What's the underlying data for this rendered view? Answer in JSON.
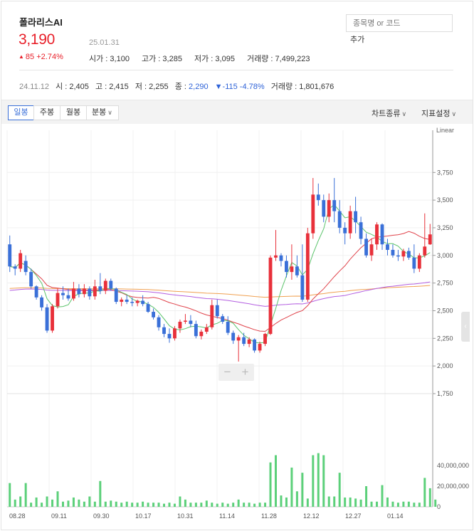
{
  "stock": {
    "name": "폴라리스AI",
    "price": "3,190",
    "date": "25.01.31",
    "change_abs": "85",
    "change_pct": "+2.74%",
    "open": "시가 : 3,100",
    "high": "고가 : 3,285",
    "low": "저가 : 3,095",
    "volume": "거래량 : 7,499,223"
  },
  "search": {
    "placeholder": "종목명 or 코드",
    "add_label": "추가"
  },
  "previous": {
    "date": "24.11.12",
    "open": "시 : 2,405",
    "high": "고 : 2,415",
    "low": "저 : 2,255",
    "close_label": "종 :",
    "close_value": "2,290",
    "change": "▼-115",
    "pct": "-4.78%",
    "volume": "거래량 : 1,801,676"
  },
  "toolbar": {
    "tabs": [
      "일봉",
      "주봉",
      "월봉",
      "분봉"
    ],
    "chart_type": "차트종류",
    "indicator": "지표설정"
  },
  "colors": {
    "up": "#e8303a",
    "down": "#3a70d8",
    "volume": "#5cd07a",
    "ma5": "#5cc46c",
    "ma20": "#e0434b",
    "ma60": "#b35ee0",
    "ma120": "#f0a050"
  },
  "chart_data": {
    "type": "candlestick",
    "price_scale": "Linear",
    "y_ticks": [
      "3,750",
      "3,500",
      "3,250",
      "3,000",
      "2,750",
      "2,500",
      "2,250",
      "2,000",
      "1,750"
    ],
    "y_range": [
      1750,
      3900
    ],
    "volume_ticks": [
      "40,000,000",
      "20,000,000",
      "0"
    ],
    "x_labels": [
      "08.28",
      "09.11",
      "09.30",
      "10.17",
      "10.31",
      "11.14",
      "11.28",
      "12.12",
      "12.27",
      "01.14"
    ],
    "candles": [
      [
        3100,
        3180,
        2850,
        2900
      ],
      [
        2900,
        2920,
        2820,
        2880
      ],
      [
        2880,
        3050,
        2850,
        3020
      ],
      [
        2950,
        3000,
        2820,
        2850
      ],
      [
        2850,
        2880,
        2700,
        2720
      ],
      [
        2720,
        2730,
        2600,
        2620
      ],
      [
        2620,
        2640,
        2500,
        2530
      ],
      [
        2530,
        2560,
        2300,
        2320
      ],
      [
        2320,
        2560,
        2300,
        2540
      ],
      [
        2540,
        2700,
        2520,
        2660
      ],
      [
        2660,
        2720,
        2600,
        2640
      ],
      [
        2640,
        2700,
        2590,
        2610
      ],
      [
        2610,
        2760,
        2590,
        2700
      ],
      [
        2700,
        2740,
        2620,
        2650
      ],
      [
        2650,
        2740,
        2620,
        2700
      ],
      [
        2700,
        2720,
        2600,
        2630
      ],
      [
        2630,
        2780,
        2600,
        2720
      ],
      [
        2720,
        2840,
        2650,
        2680
      ],
      [
        2680,
        2790,
        2650,
        2770
      ],
      [
        2770,
        2790,
        2680,
        2700
      ],
      [
        2700,
        2710,
        2560,
        2580
      ],
      [
        2580,
        2620,
        2540,
        2600
      ],
      [
        2600,
        2640,
        2560,
        2580
      ],
      [
        2580,
        2620,
        2540,
        2570
      ],
      [
        2570,
        2600,
        2540,
        2590
      ],
      [
        2590,
        2640,
        2540,
        2560
      ],
      [
        2560,
        2580,
        2480,
        2490
      ],
      [
        2490,
        2520,
        2420,
        2440
      ],
      [
        2440,
        2460,
        2320,
        2350
      ],
      [
        2350,
        2380,
        2260,
        2290
      ],
      [
        2290,
        2340,
        2210,
        2250
      ],
      [
        2250,
        2360,
        2230,
        2340
      ],
      [
        2340,
        2420,
        2300,
        2400
      ],
      [
        2400,
        2470,
        2380,
        2410
      ],
      [
        2410,
        2460,
        2350,
        2380
      ],
      [
        2380,
        2410,
        2250,
        2270
      ],
      [
        2270,
        2330,
        2240,
        2310
      ],
      [
        2310,
        2380,
        2290,
        2350
      ],
      [
        2350,
        2600,
        2330,
        2550
      ],
      [
        2550,
        2600,
        2430,
        2450
      ],
      [
        2450,
        2470,
        2380,
        2400
      ],
      [
        2400,
        2450,
        2280,
        2300
      ],
      [
        2300,
        2320,
        2200,
        2230
      ],
      [
        2230,
        2280,
        2040,
        2260
      ],
      [
        2260,
        2300,
        2180,
        2200
      ],
      [
        2200,
        2260,
        2170,
        2240
      ],
      [
        2240,
        2250,
        2120,
        2140
      ],
      [
        2140,
        2220,
        2120,
        2200
      ],
      [
        2200,
        2300,
        2180,
        2290
      ],
      [
        2290,
        3000,
        2280,
        2980
      ],
      [
        2980,
        3230,
        2950,
        3000
      ],
      [
        3000,
        3020,
        2900,
        2950
      ],
      [
        2950,
        3000,
        2800,
        2850
      ],
      [
        2850,
        3100,
        2780,
        2900
      ],
      [
        2900,
        3000,
        2800,
        2820
      ],
      [
        2820,
        3100,
        2580,
        2600
      ],
      [
        2600,
        3250,
        2580,
        3200
      ],
      [
        3200,
        3700,
        3150,
        3550
      ],
      [
        3550,
        3650,
        3450,
        3500
      ],
      [
        3500,
        3550,
        3300,
        3350
      ],
      [
        3350,
        3560,
        3300,
        3500
      ],
      [
        3500,
        3700,
        3300,
        3400
      ],
      [
        3400,
        3500,
        3200,
        3250
      ],
      [
        3250,
        3300,
        3100,
        3200
      ],
      [
        3200,
        3450,
        3150,
        3400
      ],
      [
        3400,
        3530,
        3200,
        3300
      ],
      [
        3300,
        3350,
        3100,
        3150
      ],
      [
        3150,
        3200,
        2980,
        3000
      ],
      [
        3000,
        3150,
        2950,
        3100
      ],
      [
        3100,
        3300,
        3050,
        3280
      ],
      [
        3280,
        3290,
        3050,
        3100
      ],
      [
        3100,
        3150,
        3000,
        3050
      ],
      [
        3050,
        3100,
        2980,
        3000
      ],
      [
        3000,
        3050,
        2950,
        2990
      ],
      [
        2990,
        3060,
        2950,
        3040
      ],
      [
        3040,
        3070,
        2960,
        2980
      ],
      [
        2980,
        3100,
        2840,
        2880
      ],
      [
        2880,
        3020,
        2850,
        3000
      ],
      [
        3000,
        3380,
        2980,
        3080
      ],
      [
        3100,
        3285,
        3095,
        3190
      ]
    ],
    "volume": [
      23,
      7,
      10,
      23,
      4,
      9,
      4,
      10,
      7,
      15,
      5,
      6,
      9,
      7,
      5,
      10,
      5,
      25,
      5,
      6,
      5,
      4,
      5,
      4,
      4,
      5,
      4,
      4,
      4,
      3,
      4,
      3,
      10,
      7,
      4,
      4,
      4,
      6,
      4,
      3,
      4,
      3,
      4,
      7,
      4,
      4,
      3,
      4,
      4,
      43,
      50,
      11,
      9,
      38,
      15,
      33,
      8,
      50,
      52,
      50,
      10,
      10,
      33,
      9,
      9,
      8,
      7,
      20,
      5,
      5,
      21,
      9,
      5,
      4,
      5,
      5,
      4,
      4,
      28,
      18,
      7
    ],
    "ma_series": [
      "MA5",
      "MA20",
      "MA60",
      "MA120"
    ]
  }
}
